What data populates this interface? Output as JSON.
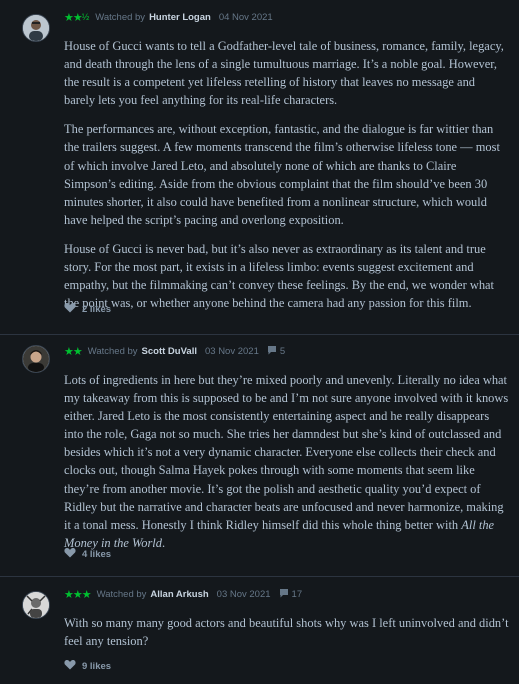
{
  "reviews": [
    {
      "stars": "★★",
      "half": "½",
      "watched_by": "Watched by",
      "author": "Hunter Logan",
      "date": "04 Nov 2021",
      "comments": "",
      "paragraphs": [
        "House of Gucci wants to tell a Godfather-level tale of business, romance, family, legacy, and death through the lens of a single tumultuous marriage. It’s a noble goal. However, the result is a competent yet lifeless retelling of history that leaves no message and barely lets you feel anything for its real-life characters.",
        "The performances are, without exception, fantastic, and the dialogue is far wittier than the trailers suggest. A few moments transcend the film’s otherwise lifeless tone — most of which involve Jared Leto, and absolutely none of which are thanks to Claire Simpson’s editing. Aside from the obvious complaint that the film should’ve been 30 minutes shorter, it also could have benefited from a nonlinear structure, which would have helped the script’s pacing and overlong exposition.",
        "House of Gucci is never bad, but it’s also never as extraordinary as its talent and true story. For the most part, it exists in a lifeless limbo: events suggest excitement and empathy, but the filmmaking can’t convey these feelings. By the end, we wonder what the point was, or whether anyone behind the camera had any passion for this film."
      ],
      "likes": "2 likes"
    },
    {
      "stars": "★★",
      "half": "",
      "watched_by": "Watched by",
      "author": "Scott DuVall",
      "date": "03 Nov 2021",
      "comments": "5",
      "paragraphs": [
        "Lots of ingredients in here but they’re mixed poorly and unevenly. Literally no idea what my takeaway from this is supposed to be and I’m not sure anyone involved with it knows either. Jared Leto is the most consistently entertaining aspect and he really disappears into the role, Gaga not so much. She tries her damndest but she’s kind of outclassed and besides which it’s not a very dynamic character. Everyone else collects their check and clocks out, though Salma Hayek pokes through with some moments that seem like they’re from another movie. It’s got the polish and aesthetic quality you’d expect of Ridley but the narrative and character beats are unfocused and never harmonize, making it a tonal mess. Honestly I think Ridley himself did this whole thing better with "
      ],
      "italic": "All the Money in the World",
      "tail": ".",
      "likes": "4 likes"
    },
    {
      "stars": "★★★",
      "half": "",
      "watched_by": "Watched by",
      "author": "Allan Arkush",
      "date": "03 Nov 2021",
      "comments": "17",
      "paragraphs": [
        "With so many many good actors and beautiful shots why was I left uninvolved and didn’t feel any tension?"
      ],
      "likes": "9 likes"
    }
  ],
  "icons": {
    "comment": "comment-icon",
    "like": "heart-icon"
  },
  "colors": {
    "background": "#14181c",
    "star_green": "#00c030",
    "text": "#b2c2d2",
    "muted": "#667788"
  }
}
